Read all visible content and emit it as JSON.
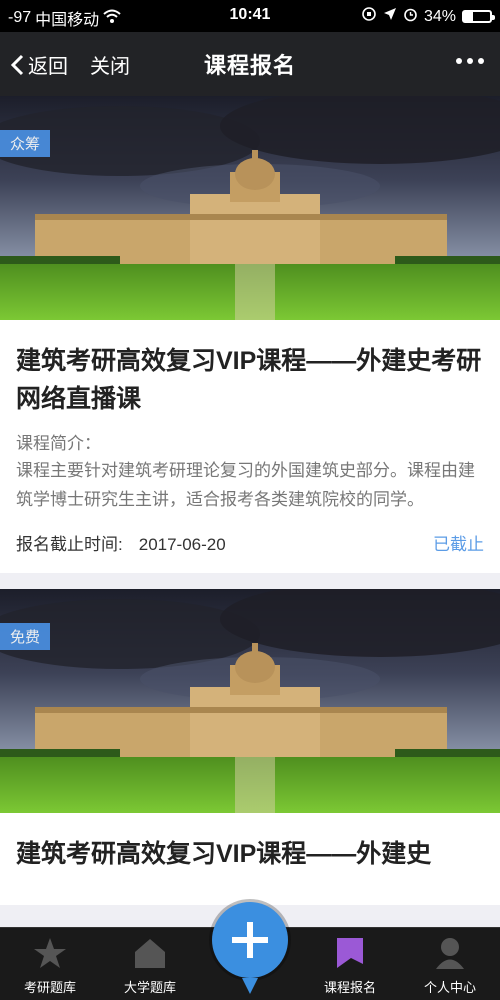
{
  "status_bar": {
    "signal": "-97",
    "carrier": "中国移动",
    "time": "10:41",
    "battery_percent": "34%",
    "battery_level": 0.34
  },
  "nav": {
    "back_label": "返回",
    "close_label": "关闭",
    "title": "课程报名"
  },
  "cards": [
    {
      "tag": "众筹",
      "title": "建筑考研高效复习VIP课程——外建史考研网络直播课",
      "intro_label": "课程简介：",
      "intro_text": "课程主要针对建筑考研理论复习的外国建筑史部分。课程由建筑学博士研究生主讲，适合报考各类建筑院校的同学。",
      "deadline_label": "报名截止时间:",
      "deadline_value": "2017-06-20",
      "status": "已截止"
    },
    {
      "tag": "免费",
      "title": "建筑考研高效复习VIP课程——外建史"
    }
  ],
  "tabs": [
    {
      "label": "考研题库",
      "icon": "star-icon"
    },
    {
      "label": "大学题库",
      "icon": "house-icon"
    },
    {
      "label": "",
      "icon": "plus-icon"
    },
    {
      "label": "课程报名",
      "icon": "flag-icon"
    },
    {
      "label": "个人中心",
      "icon": "person-icon"
    }
  ],
  "colors": {
    "accent": "#4a90e2",
    "status_text": "#5c9ce6",
    "nav_bg": "#222326",
    "tab_bg": "#1a1a1a",
    "active_tab_icon": "#9b59d6"
  }
}
